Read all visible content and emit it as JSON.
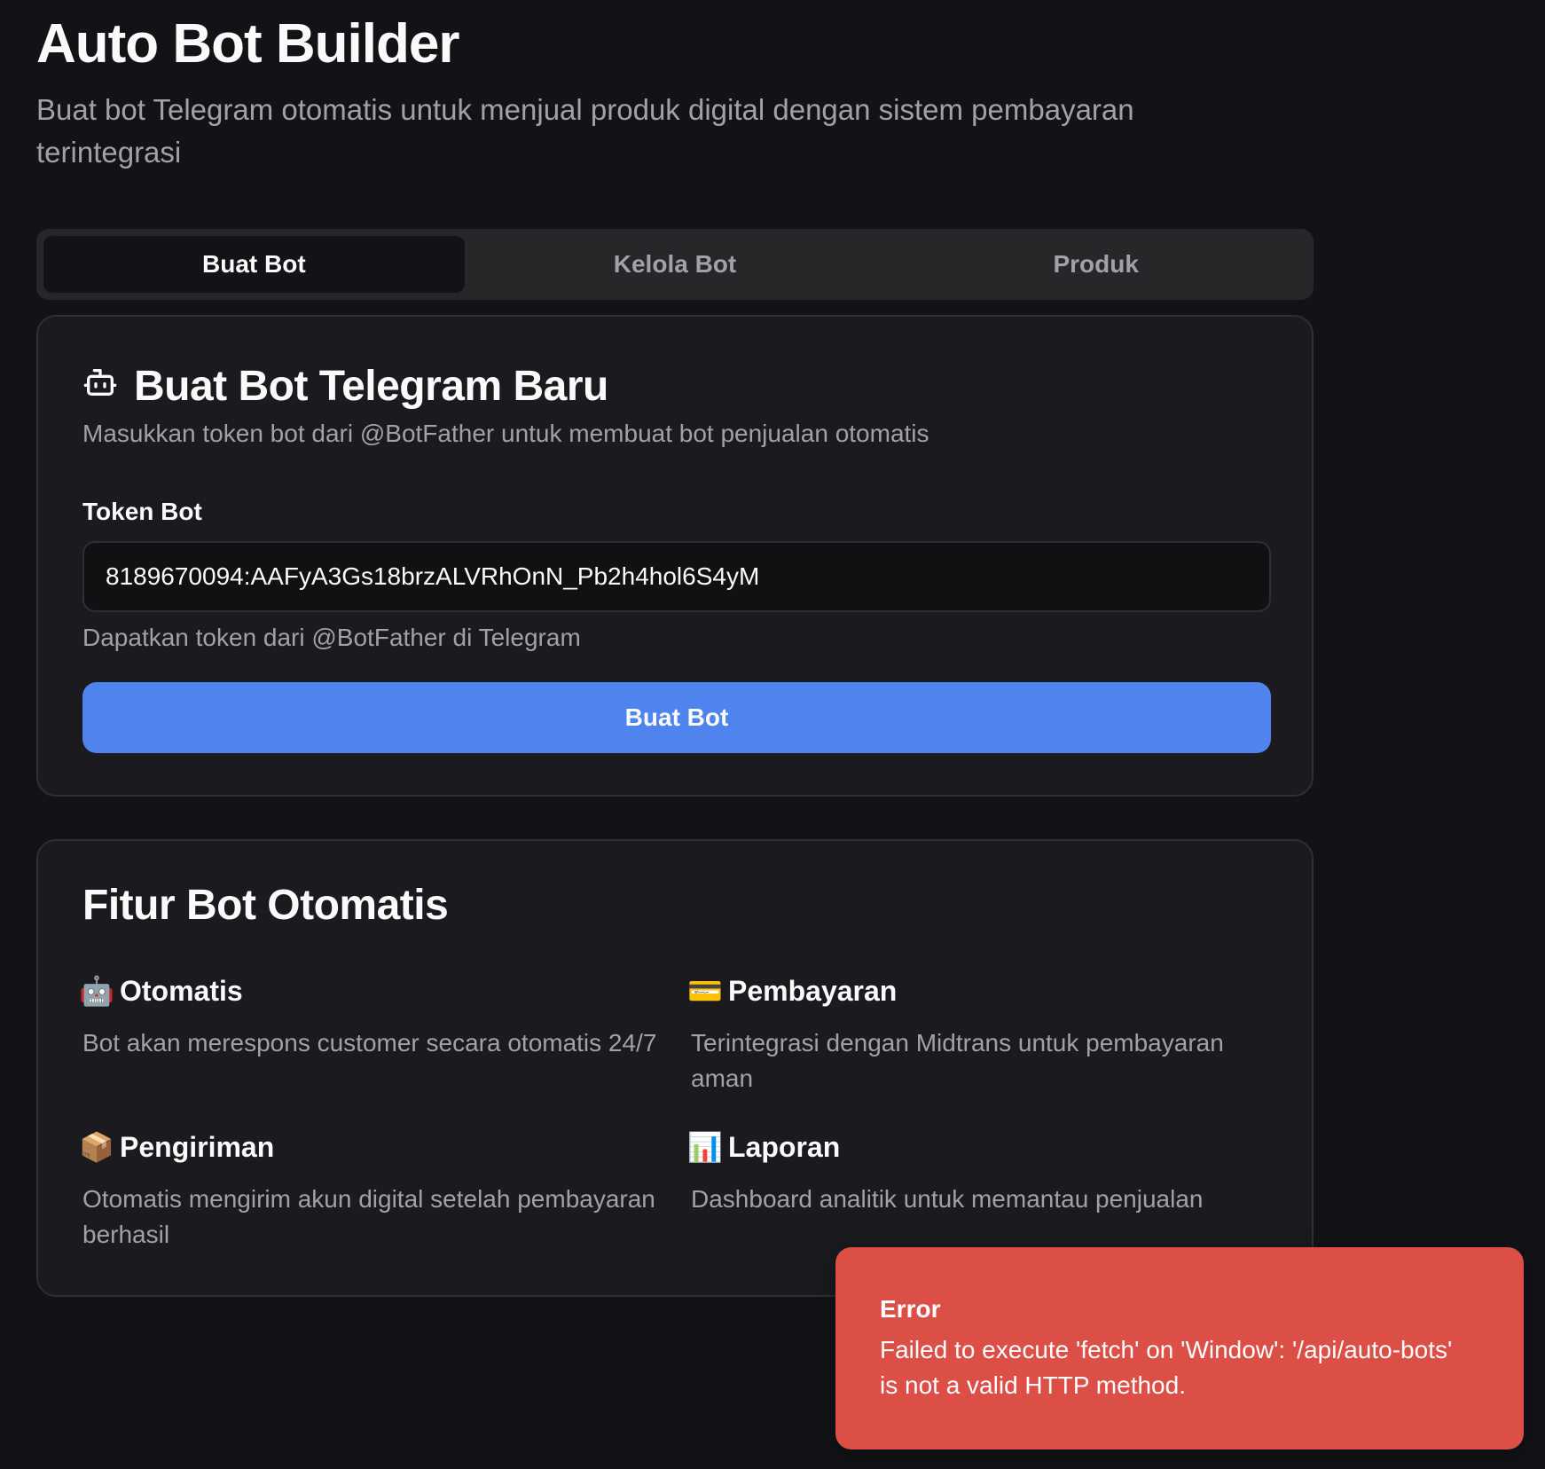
{
  "header": {
    "title": "Auto Bot Builder",
    "subtitle": "Buat bot Telegram otomatis untuk menjual produk digital dengan sistem pembayaran terintegrasi"
  },
  "tabs": [
    {
      "label": "Buat Bot",
      "active": true
    },
    {
      "label": "Kelola Bot",
      "active": false
    },
    {
      "label": "Produk",
      "active": false
    }
  ],
  "create_card": {
    "icon": "bot-icon",
    "title": "Buat Bot Telegram Baru",
    "description": "Masukkan token bot dari @BotFather untuk membuat bot penjualan otomatis",
    "token_label": "Token Bot",
    "token_value": "8189670094:AAFyA3Gs18brzALVRhOnN_Pb2h4hol6S4yM",
    "token_hint": "Dapatkan token dari @BotFather di Telegram",
    "submit_label": "Buat Bot",
    "accent_color": "#4f84ee"
  },
  "features_card": {
    "title": "Fitur Bot Otomatis",
    "items": [
      {
        "emoji": "🤖",
        "icon": "robot-icon",
        "title": "Otomatis",
        "description": "Bot akan merespons customer secara otomatis 24/7"
      },
      {
        "emoji": "💳",
        "icon": "credit-card-icon",
        "title": "Pembayaran",
        "description": "Terintegrasi dengan Midtrans untuk pembayaran aman"
      },
      {
        "emoji": "📦",
        "icon": "package-icon",
        "title": "Pengiriman",
        "description": "Otomatis mengirim akun digital setelah pembayaran berhasil"
      },
      {
        "emoji": "📊",
        "icon": "bar-chart-icon",
        "title": "Laporan",
        "description": "Dashboard analitik untuk memantau penjualan"
      }
    ]
  },
  "toast": {
    "title": "Error",
    "message": "Failed to execute 'fetch' on 'Window': '/api/auto-bots' is not a valid HTTP method.",
    "color": "#dc4f47"
  }
}
